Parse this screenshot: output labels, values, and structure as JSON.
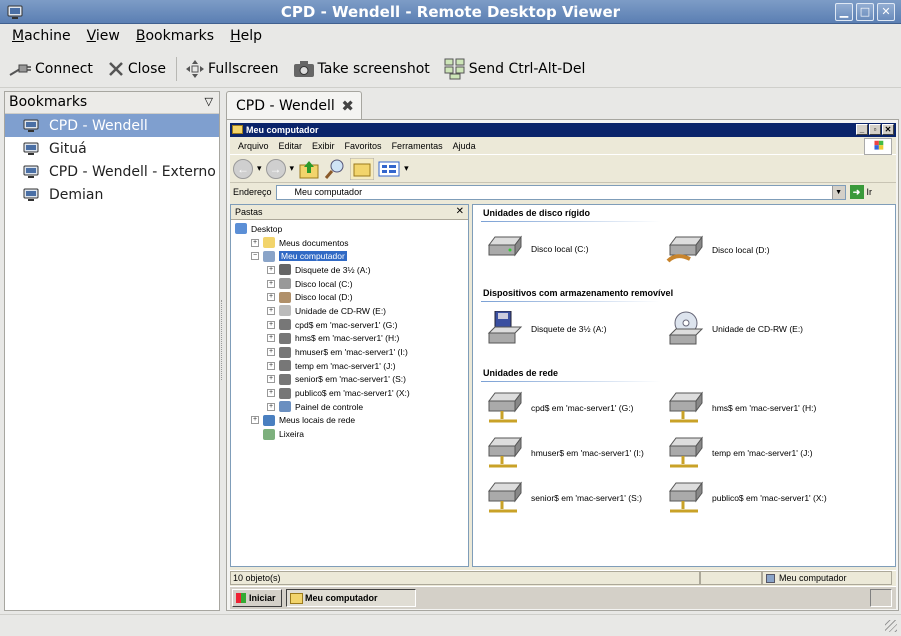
{
  "window": {
    "title": "CPD - Wendell - Remote Desktop Viewer"
  },
  "menu": [
    "Machine",
    "View",
    "Bookmarks",
    "Help"
  ],
  "toolbar": {
    "connect": "Connect",
    "close": "Close",
    "fullscreen": "Fullscreen",
    "screenshot": "Take screenshot",
    "ctrlaltdel": "Send Ctrl-Alt-Del"
  },
  "sidebar": {
    "header": "Bookmarks",
    "items": [
      "CPD - Wendell",
      "Gituá",
      "CPD - Wendell - Externo",
      "Demian"
    ]
  },
  "tab": {
    "label": "CPD - Wendell"
  },
  "remote": {
    "title": "Meu computador",
    "menu": [
      "Arquivo",
      "Editar",
      "Exibir",
      "Favoritos",
      "Ferramentas",
      "Ajuda"
    ],
    "address_label": "Endereço",
    "address_value": "Meu computador",
    "go_label": "Ir",
    "folders_header": "Pastas",
    "tree": [
      {
        "label": "Desktop",
        "level": 0,
        "pm": "",
        "color": "#5b8fd6"
      },
      {
        "label": "Meus documentos",
        "level": 1,
        "pm": "+",
        "color": "#f2d46b"
      },
      {
        "label": "Meu computador",
        "level": 1,
        "pm": "−",
        "color": "#8aa4c8",
        "selected": true
      },
      {
        "label": "Disquete de 3½ (A:)",
        "level": 2,
        "pm": "+",
        "color": "#666"
      },
      {
        "label": "Disco local (C:)",
        "level": 2,
        "pm": "+",
        "color": "#999"
      },
      {
        "label": "Disco local (D:)",
        "level": 2,
        "pm": "+",
        "color": "#b0906a"
      },
      {
        "label": "Unidade de CD-RW (E:)",
        "level": 2,
        "pm": "+",
        "color": "#bbb"
      },
      {
        "label": "cpd$ em 'mac-server1' (G:)",
        "level": 2,
        "pm": "+",
        "color": "#777"
      },
      {
        "label": "hms$ em 'mac-server1' (H:)",
        "level": 2,
        "pm": "+",
        "color": "#777"
      },
      {
        "label": "hmuser$ em 'mac-server1' (I:)",
        "level": 2,
        "pm": "+",
        "color": "#777"
      },
      {
        "label": "temp em 'mac-server1' (J:)",
        "level": 2,
        "pm": "+",
        "color": "#777"
      },
      {
        "label": "senior$ em 'mac-server1' (S:)",
        "level": 2,
        "pm": "+",
        "color": "#777"
      },
      {
        "label": "publico$ em 'mac-server1' (X:)",
        "level": 2,
        "pm": "+",
        "color": "#777"
      },
      {
        "label": "Painel de controle",
        "level": 2,
        "pm": "+",
        "color": "#6a8fc0"
      },
      {
        "label": "Meus locais de rede",
        "level": 1,
        "pm": "+",
        "color": "#4a7fc0"
      },
      {
        "label": "Lixeira",
        "level": 1,
        "pm": "",
        "color": "#7db07d"
      }
    ],
    "groups": {
      "hdd": "Unidades de disco rígido",
      "removable": "Dispositivos com armazenamento removível",
      "network": "Unidades de rede"
    },
    "items": {
      "c": "Disco local (C:)",
      "d": "Disco local (D:)",
      "a": "Disquete de 3½ (A:)",
      "e": "Unidade de CD-RW (E:)",
      "g": "cpd$ em 'mac-server1' (G:)",
      "h": "hms$ em 'mac-server1' (H:)",
      "i": "hmuser$ em 'mac-server1' (I:)",
      "j": "temp em 'mac-server1' (J:)",
      "s": "senior$ em 'mac-server1' (S:)",
      "x": "publico$ em 'mac-server1' (X:)"
    },
    "status_count": "10 objeto(s)",
    "status_location": "Meu computador",
    "start_label": "Iniciar",
    "task_label": "Meu computador"
  }
}
